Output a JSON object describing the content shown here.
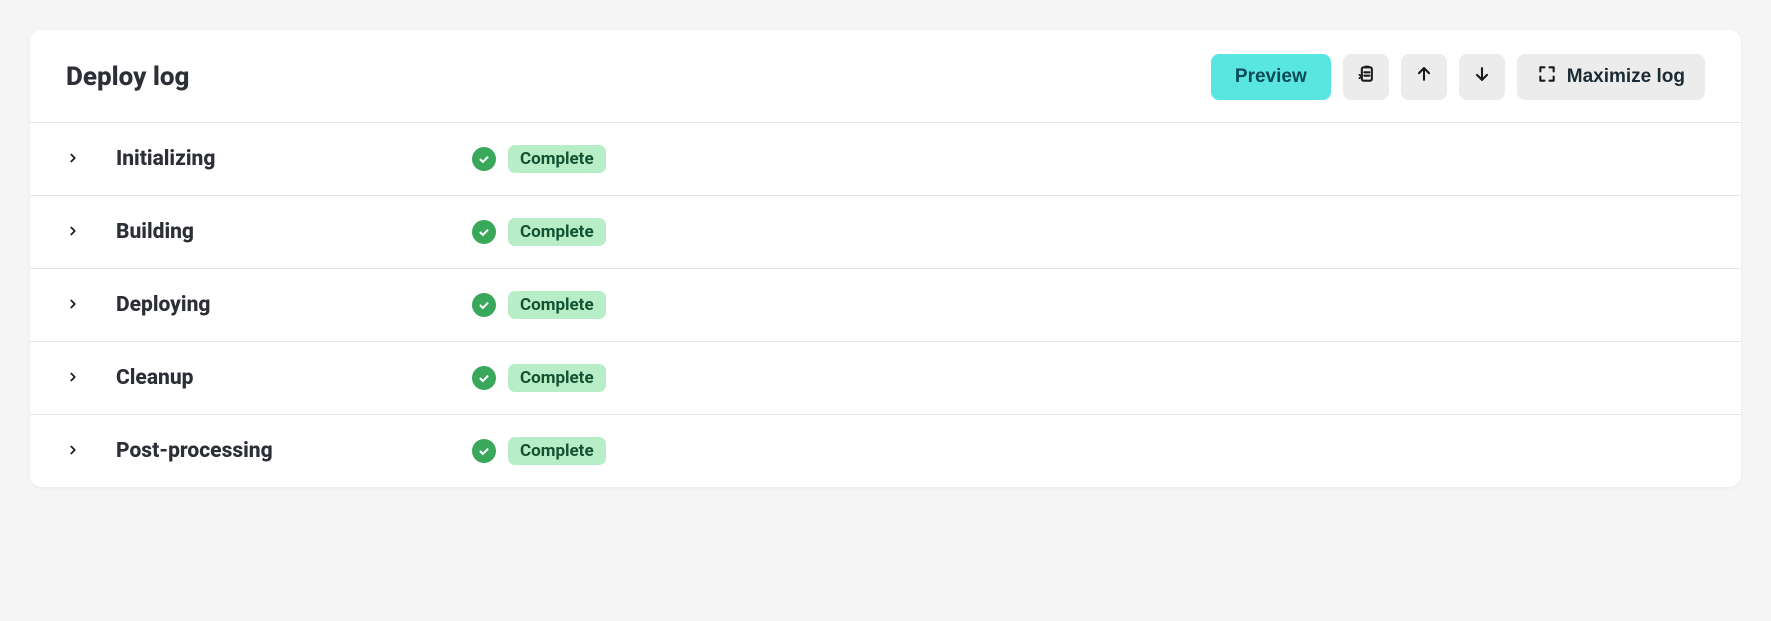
{
  "header": {
    "title": "Deploy log",
    "preview_label": "Preview",
    "maximize_label": "Maximize log"
  },
  "stages": [
    {
      "name": "Initializing",
      "status": "Complete"
    },
    {
      "name": "Building",
      "status": "Complete"
    },
    {
      "name": "Deploying",
      "status": "Complete"
    },
    {
      "name": "Cleanup",
      "status": "Complete"
    },
    {
      "name": "Post-processing",
      "status": "Complete"
    }
  ]
}
